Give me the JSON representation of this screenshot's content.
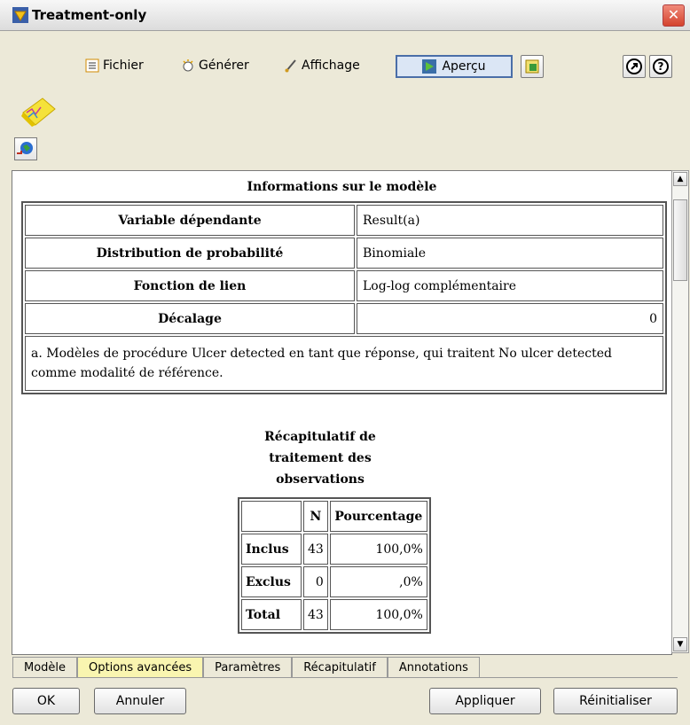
{
  "window": {
    "title": "Treatment-only"
  },
  "menu": {
    "fichier": "Fichier",
    "generer": "Générer",
    "affichage": "Affichage",
    "apercu": "Aperçu"
  },
  "model_info": {
    "title": "Informations sur le modèle",
    "rows": [
      {
        "label": "Variable dépendante",
        "value": "Result(a)"
      },
      {
        "label": "Distribution de probabilité",
        "value": "Binomiale"
      },
      {
        "label": "Fonction de lien",
        "value": "Log-log complémentaire"
      },
      {
        "label": "Décalage",
        "value": "0"
      }
    ],
    "footnote": "a. Modèles de procédure Ulcer detected en tant que réponse, qui traitent No ulcer detected comme modalité de référence."
  },
  "case_processing": {
    "title_lines": [
      "Récapitulatif de",
      "traitement des",
      "observations"
    ],
    "headers": [
      "",
      "N",
      "Pourcentage"
    ],
    "rows": [
      {
        "label": "Inclus",
        "n": "43",
        "pct": "100,0%"
      },
      {
        "label": "Exclus",
        "n": "0",
        "pct": ",0%"
      },
      {
        "label": "Total",
        "n": "43",
        "pct": "100,0%"
      }
    ]
  },
  "tabs": [
    "Modèle",
    "Options avancées",
    "Paramètres",
    "Récapitulatif",
    "Annotations"
  ],
  "active_tab": "Options avancées",
  "buttons": {
    "ok": "OK",
    "annuler": "Annuler",
    "appliquer": "Appliquer",
    "reinitialiser": "Réinitialiser"
  },
  "colors": {
    "active_tab": "#f9f5b0",
    "close": "#d4432e"
  }
}
